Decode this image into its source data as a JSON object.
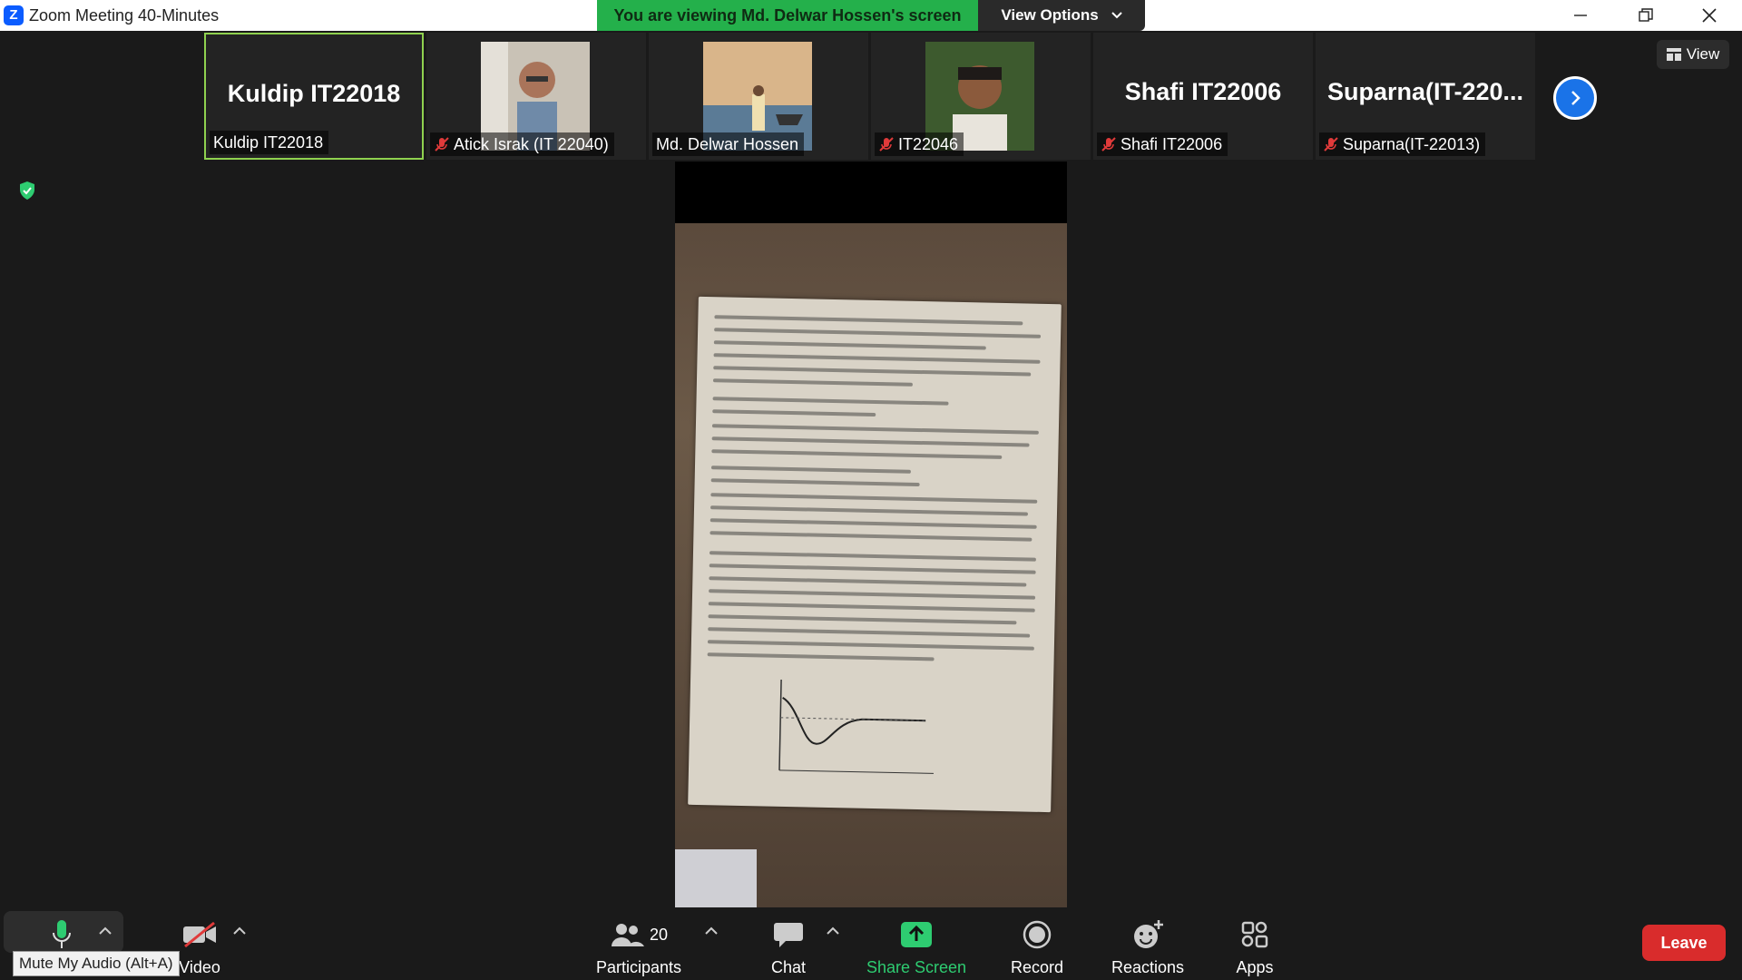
{
  "window": {
    "title": "Zoom Meeting 40-Minutes",
    "banner": "You are viewing Md. Delwar Hossen's screen",
    "view_options": "View Options"
  },
  "gallery": {
    "tiles": [
      {
        "big_name": "Kuldip IT22018",
        "label": "Kuldip IT22018",
        "muted": false,
        "has_video": false
      },
      {
        "big_name": "",
        "label": "Atick Israk (IT 22040)",
        "muted": true,
        "has_video": true
      },
      {
        "big_name": "",
        "label": "Md. Delwar Hossen",
        "muted": false,
        "has_video": true
      },
      {
        "big_name": "",
        "label": "IT22046",
        "muted": true,
        "has_video": true
      },
      {
        "big_name": "Shafi IT22006",
        "label": "Shafi IT22006",
        "muted": true,
        "has_video": false
      },
      {
        "big_name": "Suparna(IT-220...",
        "label": "Suparna(IT-22013)",
        "muted": true,
        "has_video": false
      }
    ],
    "view_label": "View"
  },
  "toolbar": {
    "mute_tooltip": "Mute My Audio (Alt+A)",
    "video_label": "Video",
    "participants_label": "Participants",
    "participants_count": "20",
    "chat_label": "Chat",
    "share_label": "Share Screen",
    "record_label": "Record",
    "reactions_label": "Reactions",
    "apps_label": "Apps",
    "leave_label": "Leave"
  },
  "colors": {
    "banner": "#24b04b",
    "share": "#2ecc71",
    "leave": "#d92c2c",
    "active_speaker": "#8fd14f"
  }
}
